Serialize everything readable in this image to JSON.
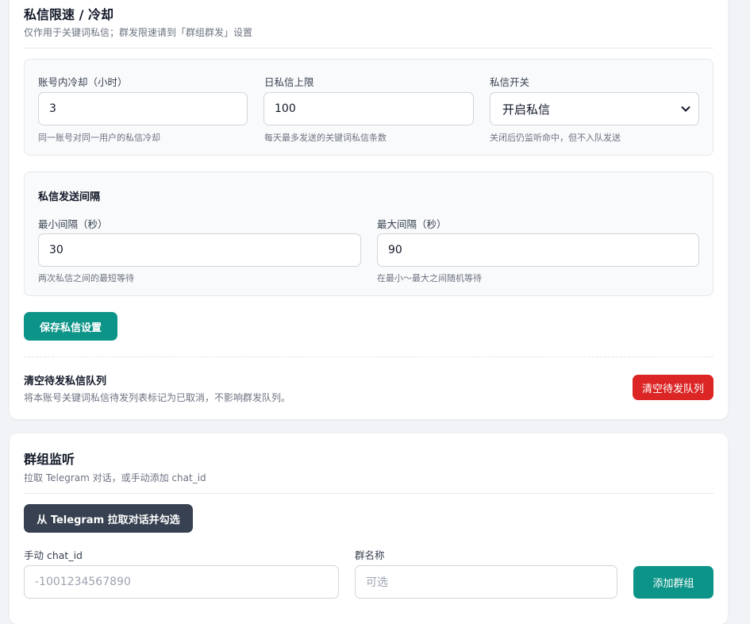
{
  "dm": {
    "title": "私信限速 / 冷却",
    "subtitle": "仅作用于关键词私信；群发限速请到「群组群发」设置",
    "cooldown": {
      "label": "账号内冷却（小时）",
      "value": "3",
      "hint": "同一账号对同一用户的私信冷却"
    },
    "daily_limit": {
      "label": "日私信上限",
      "value": "100",
      "hint": "每天最多发送的关键词私信条数"
    },
    "switch": {
      "label": "私信开关",
      "value": "开启私信",
      "hint": "关闭后仍监听命中，但不入队发送"
    },
    "interval": {
      "title": "私信发送间隔",
      "min": {
        "label": "最小间隔（秒）",
        "value": "30",
        "hint": "两次私信之间的最短等待"
      },
      "max": {
        "label": "最大间隔（秒）",
        "value": "90",
        "hint": "在最小～最大之间随机等待"
      }
    },
    "save_label": "保存私信设置",
    "clear": {
      "title": "清空待发私信队列",
      "desc": "将本账号关键词私信待发列表标记为已取消，不影响群发队列。",
      "button": "清空待发队列"
    }
  },
  "group": {
    "title": "群组监听",
    "subtitle": "拉取 Telegram 对话，或手动添加 chat_id",
    "fetch_label": "从 Telegram 拉取对话并勾选",
    "chat_id": {
      "label": "手动 chat_id",
      "placeholder": "-1001234567890"
    },
    "name": {
      "label": "群名称",
      "placeholder": "可选"
    },
    "add_label": "添加群组"
  },
  "icons": {
    "select_chevron": "chevron-down-icon"
  },
  "colors": {
    "primary": "#0d9488",
    "danger": "#dc2626",
    "dark": "#374151"
  }
}
